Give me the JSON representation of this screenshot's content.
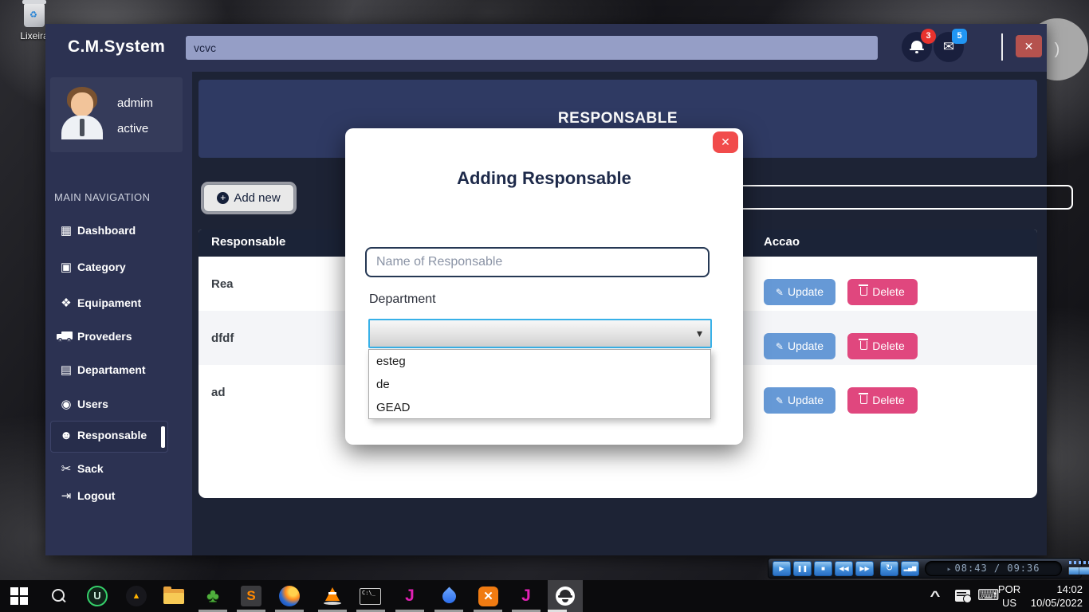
{
  "icons": {
    "dashboard": "▦",
    "category": "▣",
    "equipament": "❖",
    "departament": "▤",
    "users": "◉",
    "responsable": "☻",
    "sack": "✂",
    "logout": "⇥",
    "envelope": "✉",
    "edit": "✎",
    "close": "✕",
    "plus": "+",
    "caret_down": "▾",
    "play": "▶",
    "pause": "❚❚",
    "stop": "■",
    "rewind": "◀◀",
    "forward": "▶▶",
    "loop": "↻",
    "equalizer": "▂▄▆",
    "up": "▲",
    "display_arrow": "▸",
    "recycle": "♻",
    "clover": "♣",
    "keyboard": "⌨",
    "chevron_up": "^"
  },
  "colors": {
    "navbar": "#2c3252",
    "content_bg": "#1d2335",
    "banner": "#2f3a63",
    "table_header": "#1b2337",
    "update_button": "#6699d6",
    "delete_button": "#e0477e",
    "select_focus_border": "#38b1e8",
    "modal_close": "#f14b4b",
    "badge_red": "#e8322d",
    "badge_blue": "#2196f3",
    "nav_search_bg": "#959ec6"
  },
  "desktop": {
    "recycle_bin_label": "Lixeira",
    "media_player": {
      "time_display": "08:43 / 09:36"
    },
    "taskbar": {
      "iobit_letter": "U",
      "sublime_letter": "S",
      "cmd_text": "C:\\_",
      "jdownloader_letter": "J",
      "jdownloader2_letter": "J",
      "xampp_letter": "✕",
      "tray": {
        "language_top": "POR",
        "language_bottom": "US",
        "time": "14:02",
        "date": "10/05/2022"
      }
    }
  },
  "app": {
    "brand": "C.M.System",
    "topbar": {
      "search_value": "vcvc",
      "bell_badge": "3",
      "mail_badge": "5"
    },
    "user": {
      "name": "admim",
      "status": "active"
    },
    "sidebar": {
      "section": "MAIN NAVIGATION",
      "items": [
        "Dashboard",
        "Category",
        "Equipament",
        "Proveders",
        "Departament",
        "Users",
        "Responsable",
        "Sack",
        "Logout"
      ]
    },
    "page": {
      "title": "RESPONSABLE",
      "add_new": "Add new"
    },
    "table": {
      "col_responsable": "Responsable",
      "col_accao": "Accao",
      "rows": [
        "Rea",
        "dfdf",
        "ad"
      ],
      "update": "Update",
      "delete": "Delete"
    },
    "modal": {
      "title": "Adding Responsable",
      "name_placeholder": "Name of Responsable",
      "department_label": "Department",
      "options": [
        "esteg",
        "de",
        "GEAD"
      ]
    }
  }
}
